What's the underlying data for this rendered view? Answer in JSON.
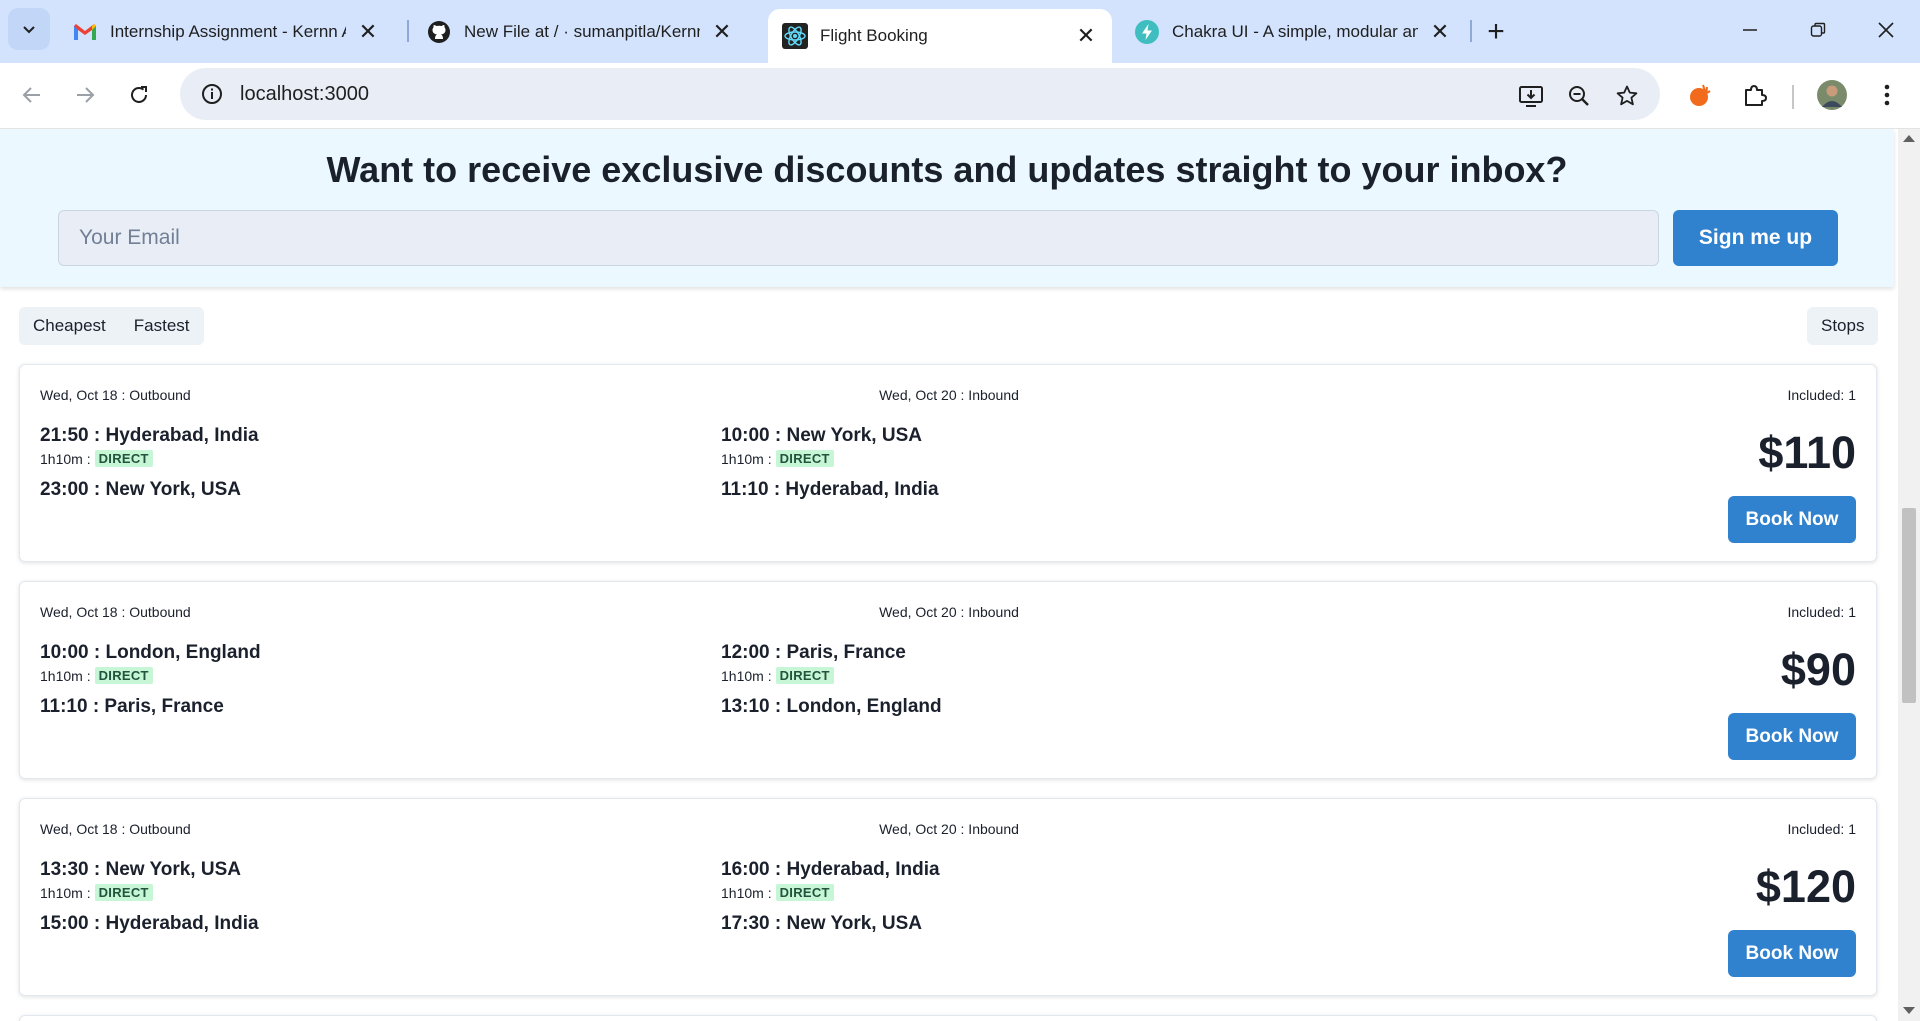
{
  "browser": {
    "tabs": [
      {
        "title": "Internship Assignment - Kernn Aut",
        "favicon": "gmail-icon",
        "active": false
      },
      {
        "title": "New File at / · sumanpitla/Kernn-a",
        "favicon": "github-icon",
        "active": false
      },
      {
        "title": "Flight Booking",
        "favicon": "react-icon",
        "active": true
      },
      {
        "title": "Chakra UI - A simple, modular and",
        "favicon": "chakra-icon",
        "active": false
      }
    ],
    "close_glyph": "✕",
    "new_tab_glyph": "+",
    "url": "localhost:3000"
  },
  "newsletter": {
    "heading": "Want to receive exclusive discounts and updates straight to your inbox?",
    "email_placeholder": "Your Email",
    "email_value": "",
    "signup_label": "Sign me up"
  },
  "sort": {
    "options": [
      "Cheapest",
      "Fastest"
    ],
    "stops_label": "Stops"
  },
  "flights": [
    {
      "outbound_header": "Wed, Oct 18 : Outbound",
      "inbound_header": "Wed, Oct 20 : Inbound",
      "included": "Included: 1",
      "outbound": {
        "depart": "21:50 : Hyderabad, India",
        "duration": "1h10m :",
        "stops": "DIRECT",
        "arrive": "23:00 : New York, USA"
      },
      "inbound": {
        "depart": "10:00 : New York, USA",
        "duration": "1h10m :",
        "stops": "DIRECT",
        "arrive": "11:10 : Hyderabad, India"
      },
      "price": "$110",
      "book_label": "Book Now"
    },
    {
      "outbound_header": "Wed, Oct 18 : Outbound",
      "inbound_header": "Wed, Oct 20 : Inbound",
      "included": "Included: 1",
      "outbound": {
        "depart": "10:00 : London, England",
        "duration": "1h10m :",
        "stops": "DIRECT",
        "arrive": "11:10 : Paris, France"
      },
      "inbound": {
        "depart": "12:00 : Paris, France",
        "duration": "1h10m :",
        "stops": "DIRECT",
        "arrive": "13:10 : London, England"
      },
      "price": "$90",
      "book_label": "Book Now"
    },
    {
      "outbound_header": "Wed, Oct 18 : Outbound",
      "inbound_header": "Wed, Oct 20 : Inbound",
      "included": "Included: 1",
      "outbound": {
        "depart": "13:30 : New York, USA",
        "duration": "1h10m :",
        "stops": "DIRECT",
        "arrive": "15:00 : Hyderabad, India"
      },
      "inbound": {
        "depart": "16:00 : Hyderabad, India",
        "duration": "1h10m :",
        "stops": "DIRECT",
        "arrive": "17:30 : New York, USA"
      },
      "price": "$120",
      "book_label": "Book Now"
    }
  ],
  "colors": {
    "accent": "#3182ce",
    "newsletter_bg": "#ebf8ff",
    "badge_bg": "#c6f6d5",
    "badge_text": "#22543d",
    "tabstrip_bg": "#d3e3fd"
  }
}
